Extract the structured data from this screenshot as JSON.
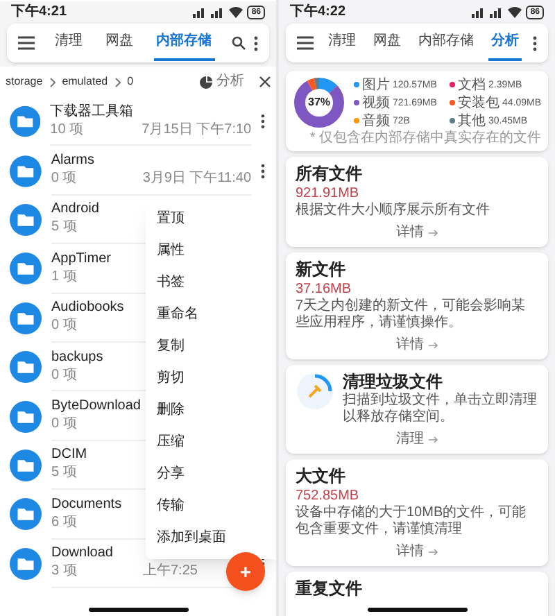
{
  "left": {
    "status_bar": {
      "time": "下午4:21",
      "battery": "86"
    },
    "tabs": [
      {
        "label": "清理",
        "selected": false
      },
      {
        "label": "网盘",
        "selected": false
      },
      {
        "label": "内部存储",
        "selected": true
      }
    ],
    "breadcrumb": [
      "storage",
      "emulated",
      "0"
    ],
    "analyze_label": "分析",
    "files": [
      {
        "name": "下载器工具箱",
        "count": "10 项",
        "date": "7月15日 下午7:10"
      },
      {
        "name": "Alarms",
        "count": "0 项",
        "date": "3月9日 下午11:40"
      },
      {
        "name": "Android",
        "count": "5 项"
      },
      {
        "name": "AppTimer",
        "count": "1 项"
      },
      {
        "name": "Audiobooks",
        "count": "0 项"
      },
      {
        "name": "backups",
        "count": "0 项"
      },
      {
        "name": "ByteDownload",
        "count": "0 项"
      },
      {
        "name": "DCIM",
        "count": "5 项"
      },
      {
        "name": "Documents",
        "count": "6 项"
      },
      {
        "name": "Download",
        "count": "3 项",
        "date": "上午7:25"
      }
    ],
    "context_menu": [
      "置顶",
      "属性",
      "书签",
      "重命名",
      "复制",
      "剪切",
      "删除",
      "压缩",
      "分享",
      "传输",
      "添加到桌面"
    ],
    "fab": "+"
  },
  "right": {
    "status_bar": {
      "time": "下午4:22",
      "battery": "86"
    },
    "tabs": [
      {
        "label": "清理",
        "selected": false
      },
      {
        "label": "网盘",
        "selected": false
      },
      {
        "label": "内部存储",
        "selected": false
      },
      {
        "label": "分析",
        "selected": true
      }
    ],
    "storage_chart": {
      "percent": "37%",
      "note": "* 仅包含在内部存储中真实存在的文件",
      "legend": [
        {
          "label": "图片",
          "size": "120.57MB",
          "color": "#2196f3"
        },
        {
          "label": "文档",
          "size": "2.39MB",
          "color": "#e91e63"
        },
        {
          "label": "视频",
          "size": "721.69MB",
          "color": "#7e57c2"
        },
        {
          "label": "安装包",
          "size": "44.09MB",
          "color": "#ff5722"
        },
        {
          "label": "音频",
          "size": "72B",
          "color": "#ff9800"
        },
        {
          "label": "其他",
          "size": "30.45MB",
          "color": "#607d8b"
        }
      ]
    },
    "cards": [
      {
        "kind": "info",
        "title": "所有文件",
        "size": "921.91MB",
        "description": "根据文件大小顺序展示所有文件",
        "action": "详情"
      },
      {
        "kind": "info",
        "title": "新文件",
        "size": "37.16MB",
        "description": "7天之内创建的新文件，可能会影响某些应用程序，请谨慎操作。",
        "action": "详情"
      },
      {
        "kind": "clean",
        "title": "清理垃圾文件",
        "description": "扫描到垃圾文件，单击立即清理以释放存储空间。",
        "action": "清理"
      },
      {
        "kind": "info",
        "title": "大文件",
        "size": "752.85MB",
        "description": "设备中存储的大于10MB的文件，可能包含重要文件，请谨慎清理",
        "action": "详情"
      },
      {
        "kind": "title_only",
        "title": "重复文件"
      }
    ]
  }
}
